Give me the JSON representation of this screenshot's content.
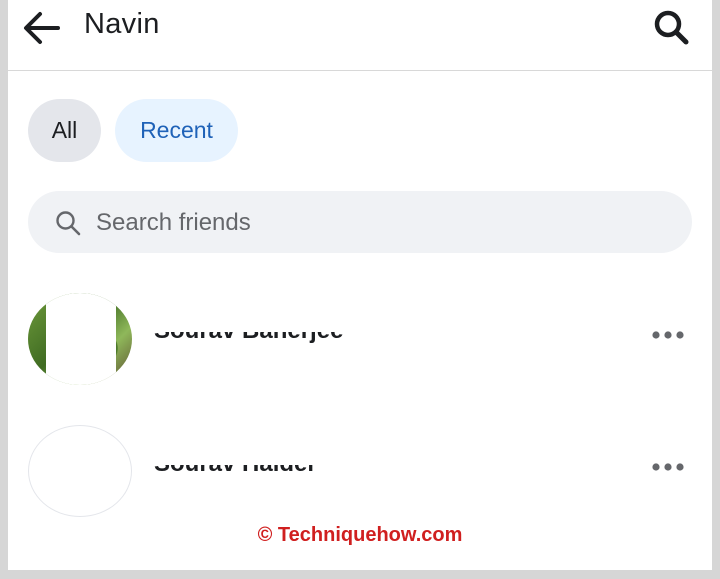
{
  "header": {
    "title": "Navin",
    "back_icon": "arrow-left-icon",
    "search_icon": "search-icon"
  },
  "filters": {
    "chips": [
      {
        "label": "All",
        "selected": false
      },
      {
        "label": "Recent",
        "selected": true
      }
    ]
  },
  "search": {
    "placeholder": "Search friends",
    "icon": "magnifier-icon"
  },
  "friends": [
    {
      "name": "Sourav Banerjee",
      "avatar": "photo"
    },
    {
      "name": "Sourav Halder",
      "avatar": "blank"
    }
  ],
  "watermark": "© Techniquehow.com",
  "colors": {
    "accent_text": "#1f62b8",
    "accent_bg": "#e7f3ff",
    "chip_bg": "#e4e6eb",
    "search_bg": "#f0f2f5",
    "watermark": "#d01f1f"
  }
}
